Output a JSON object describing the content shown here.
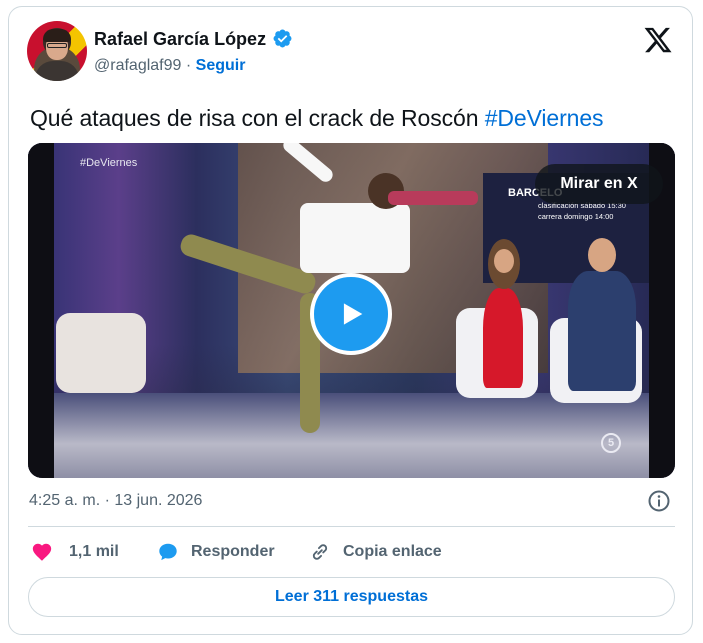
{
  "author": {
    "name": "Rafael García López",
    "handle": "@rafaglaf99",
    "separator": "·",
    "follow_label": "Seguir",
    "verified": true
  },
  "tweet": {
    "text": "Qué ataques de risa con el crack de Roscón ",
    "hashtag": "#DeViernes"
  },
  "media": {
    "video_tag": "#DeViernes",
    "info_city": "BARCELO",
    "info_row1": "clasificación sábado   15:30",
    "info_row2": "carrera domingo   14:00",
    "watch_label": "Mirar en X",
    "channel_logo": "5"
  },
  "meta": {
    "timestamp": "4:25 a. m. · 13 jun. 2026"
  },
  "actions": {
    "like_count": "1,1 mil",
    "reply_label": "Responder",
    "copy_label": "Copia enlace",
    "replies_button": "Leer 311 respuestas"
  },
  "colors": {
    "accent": "#1d9bf0",
    "link": "#006fd6",
    "like": "#f91880",
    "muted": "#536471"
  },
  "icons": [
    "verified-badge-icon",
    "x-logo-icon",
    "play-icon",
    "info-icon",
    "heart-icon",
    "reply-bubble-icon",
    "link-icon"
  ]
}
